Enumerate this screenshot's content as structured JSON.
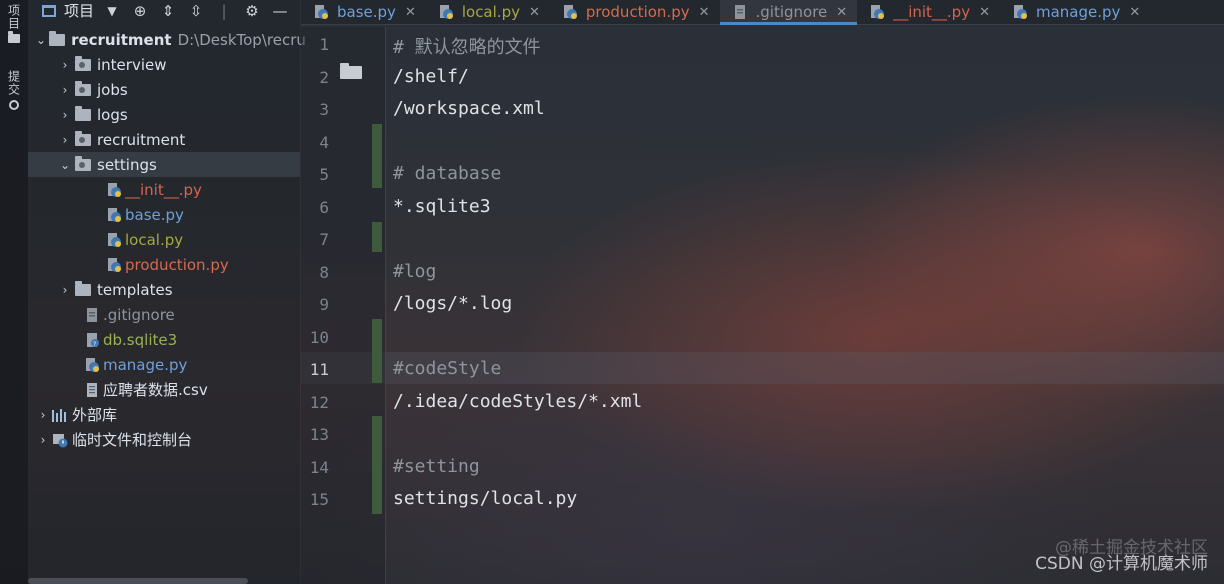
{
  "side_tabs": {
    "project_label": "项目",
    "commit_label": "提交"
  },
  "project_panel": {
    "title": "项目",
    "tree": [
      {
        "label": "recruitment",
        "hint": "D:\\DeskTop\\recru"
      },
      {
        "label": "interview"
      },
      {
        "label": "jobs"
      },
      {
        "label": "logs"
      },
      {
        "label": "recruitment"
      },
      {
        "label": "settings"
      },
      {
        "label": "__init__.py"
      },
      {
        "label": "base.py"
      },
      {
        "label": "local.py"
      },
      {
        "label": "production.py"
      },
      {
        "label": "templates"
      },
      {
        "label": ".gitignore"
      },
      {
        "label": "db.sqlite3"
      },
      {
        "label": "manage.py"
      },
      {
        "label": "应聘者数据.csv"
      },
      {
        "label": "外部库"
      },
      {
        "label": "临时文件和控制台"
      }
    ]
  },
  "tabs": [
    {
      "label": "base.py"
    },
    {
      "label": "local.py"
    },
    {
      "label": "production.py"
    },
    {
      "label": ".gitignore"
    },
    {
      "label": "__init__.py"
    },
    {
      "label": "manage.py"
    }
  ],
  "editor": {
    "current_line": 11,
    "line_numbers": [
      "1",
      "2",
      "3",
      "4",
      "5",
      "6",
      "7",
      "8",
      "9",
      "10",
      "11",
      "12",
      "13",
      "14",
      "15"
    ],
    "lines": [
      "# 默认忽略的文件",
      "/shelf/",
      "/workspace.xml",
      "",
      "# database",
      "*.sqlite3",
      "",
      "#log",
      "/logs/*.log",
      "",
      "#codeStyle",
      "/.idea/codeStyles/*.xml",
      "",
      "#setting",
      "settings/local.py"
    ]
  },
  "watermark": {
    "text": "CSDN @计算机魔术师",
    "faint": "@稀土掘金技术社区"
  },
  "colors": {
    "active_tab_underline": "#4a88c7",
    "change_marker": "#3e5c3b",
    "modified_file": "#d6634e",
    "added_file": "#a6a93e"
  }
}
